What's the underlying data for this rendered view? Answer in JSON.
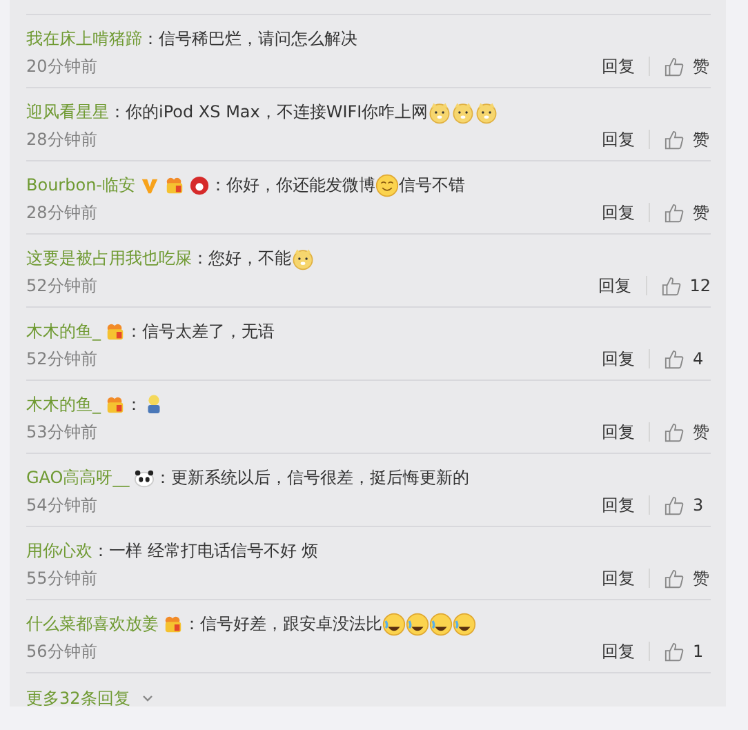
{
  "comments": [
    {
      "user": "我在床上啃猪蹄",
      "colon": "：",
      "text": "信号稀巴烂，请问怎么解决",
      "time": "20分钟前",
      "reply": "回复",
      "likes": "赞"
    },
    {
      "user": "迎风看星星",
      "colon": "：",
      "text": "你的iPod XS Max，不连接WIFI你咋上网",
      "emojis": [
        {
          "kind": "dog"
        },
        {
          "kind": "dog"
        },
        {
          "kind": "dog"
        }
      ],
      "time": "28分钟前",
      "reply": "回复",
      "likes": "赞"
    },
    {
      "user": "Bourbon-临安",
      "badges": [
        {
          "kind": "v"
        },
        {
          "kind": "fan"
        },
        {
          "kind": "red"
        }
      ],
      "colon": "：",
      "text": "你好，你还能发微博",
      "emojis": [
        {
          "kind": "smile"
        }
      ],
      "text_after": "信号不错",
      "time": "28分钟前",
      "reply": "回复",
      "likes": "赞"
    },
    {
      "user": "这要是被占用我也吃屎",
      "colon": "：",
      "text": "您好，不能",
      "emojis": [
        {
          "kind": "dog"
        }
      ],
      "time": "52分钟前",
      "reply": "回复",
      "likes": "12"
    },
    {
      "user": "木木的鱼_",
      "badges": [
        {
          "kind": "fan"
        }
      ],
      "colon": "：",
      "text": "信号太差了，无语",
      "time": "52分钟前",
      "reply": "回复",
      "likes": "4"
    },
    {
      "user": "木木的鱼_",
      "badges": [
        {
          "kind": "fan"
        }
      ],
      "colon": "：",
      "emojis": [
        {
          "kind": "figure"
        }
      ],
      "time": "53分钟前",
      "reply": "回复",
      "likes": "赞"
    },
    {
      "user": "GAO高高呀__",
      "badges": [
        {
          "kind": "panda"
        }
      ],
      "colon": "：",
      "text": "更新系统以后，信号很差，挺后悔更新的",
      "time": "54分钟前",
      "reply": "回复",
      "likes": "3"
    },
    {
      "user": "用你心欢",
      "colon": "：",
      "text": "一样 经常打电话信号不好 烦",
      "time": "55分钟前",
      "reply": "回复",
      "likes": "赞"
    },
    {
      "user": "什么菜都喜欢放姜",
      "badges": [
        {
          "kind": "fan"
        }
      ],
      "colon": "：",
      "text": "信号好差，跟安卓没法比",
      "emojis": [
        {
          "kind": "laugh"
        },
        {
          "kind": "laugh"
        },
        {
          "kind": "laugh"
        },
        {
          "kind": "laugh"
        }
      ],
      "time": "56分钟前",
      "reply": "回复",
      "likes": "1"
    }
  ],
  "more": {
    "label": "更多32条回复"
  }
}
